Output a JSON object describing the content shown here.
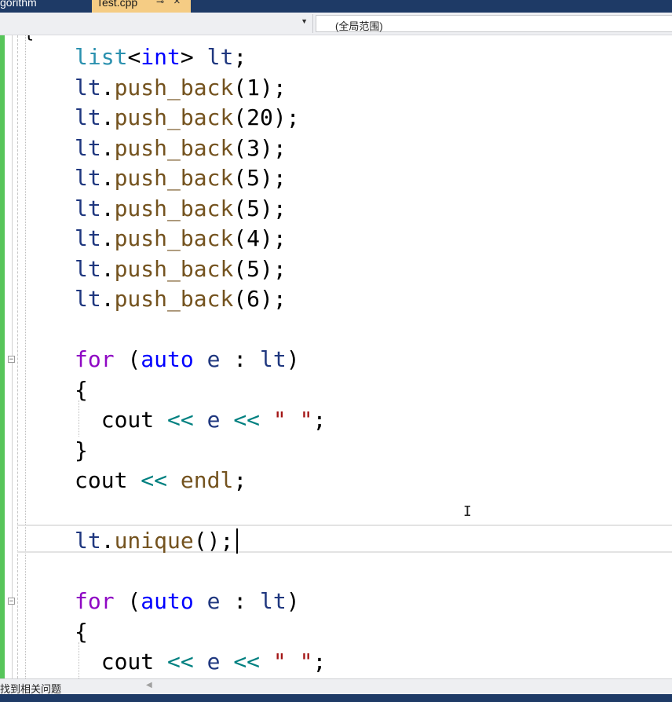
{
  "tabs": {
    "inactive_label": "gorithm",
    "active_label": "Test.cpp",
    "pin_glyph": "⊸",
    "close_glyph": "×"
  },
  "navbar": {
    "scope_label": "(全局范围)"
  },
  "editor": {
    "top_glyph": "{",
    "caret_glyph": "I",
    "lines": [
      [
        {
          "t": "list",
          "c": "t-type"
        },
        {
          "t": "<"
        },
        {
          "t": "int",
          "c": "t-kw"
        },
        {
          "t": "> "
        },
        {
          "t": "lt",
          "c": "t-var"
        },
        {
          "t": ";"
        }
      ],
      [
        {
          "t": "lt",
          "c": "t-var"
        },
        {
          "t": "."
        },
        {
          "t": "push_back",
          "c": "t-fn"
        },
        {
          "t": "(1);"
        }
      ],
      [
        {
          "t": "lt",
          "c": "t-var"
        },
        {
          "t": "."
        },
        {
          "t": "push_back",
          "c": "t-fn"
        },
        {
          "t": "(20);"
        }
      ],
      [
        {
          "t": "lt",
          "c": "t-var"
        },
        {
          "t": "."
        },
        {
          "t": "push_back",
          "c": "t-fn"
        },
        {
          "t": "(3);"
        }
      ],
      [
        {
          "t": "lt",
          "c": "t-var"
        },
        {
          "t": "."
        },
        {
          "t": "push_back",
          "c": "t-fn"
        },
        {
          "t": "(5);"
        }
      ],
      [
        {
          "t": "lt",
          "c": "t-var"
        },
        {
          "t": "."
        },
        {
          "t": "push_back",
          "c": "t-fn"
        },
        {
          "t": "(5);"
        }
      ],
      [
        {
          "t": "lt",
          "c": "t-var"
        },
        {
          "t": "."
        },
        {
          "t": "push_back",
          "c": "t-fn"
        },
        {
          "t": "(4);"
        }
      ],
      [
        {
          "t": "lt",
          "c": "t-var"
        },
        {
          "t": "."
        },
        {
          "t": "push_back",
          "c": "t-fn"
        },
        {
          "t": "(5);"
        }
      ],
      [
        {
          "t": "lt",
          "c": "t-var"
        },
        {
          "t": "."
        },
        {
          "t": "push_back",
          "c": "t-fn"
        },
        {
          "t": "(6);"
        }
      ],
      [],
      [
        {
          "t": "for",
          "c": "t-ctl"
        },
        {
          "t": " ("
        },
        {
          "t": "auto",
          "c": "t-kw"
        },
        {
          "t": " "
        },
        {
          "t": "e",
          "c": "t-var"
        },
        {
          "t": " : "
        },
        {
          "t": "lt",
          "c": "t-var"
        },
        {
          "t": ")"
        }
      ],
      [
        {
          "t": "{"
        }
      ],
      [
        {
          "t": "  "
        },
        {
          "t": "cout",
          "c": ""
        },
        {
          "t": " "
        },
        {
          "t": "<<",
          "c": "t-op"
        },
        {
          "t": " "
        },
        {
          "t": "e",
          "c": "t-var"
        },
        {
          "t": " "
        },
        {
          "t": "<<",
          "c": "t-op"
        },
        {
          "t": " "
        },
        {
          "t": "\" \"",
          "c": "t-str"
        },
        {
          "t": ";"
        }
      ],
      [
        {
          "t": "}"
        }
      ],
      [
        {
          "t": "cout"
        },
        {
          "t": " "
        },
        {
          "t": "<<",
          "c": "t-op"
        },
        {
          "t": " "
        },
        {
          "t": "endl",
          "c": "t-fn"
        },
        {
          "t": ";"
        }
      ],
      [],
      [
        {
          "t": "lt",
          "c": "t-var"
        },
        {
          "t": "."
        },
        {
          "t": "unique",
          "c": "t-fn"
        },
        {
          "t": "();"
        }
      ],
      [],
      [
        {
          "t": "for",
          "c": "t-ctl"
        },
        {
          "t": " ("
        },
        {
          "t": "auto",
          "c": "t-kw"
        },
        {
          "t": " "
        },
        {
          "t": "e",
          "c": "t-var"
        },
        {
          "t": " : "
        },
        {
          "t": "lt",
          "c": "t-var"
        },
        {
          "t": ")"
        }
      ],
      [
        {
          "t": "{"
        }
      ],
      [
        {
          "t": "  "
        },
        {
          "t": "cout"
        },
        {
          "t": " "
        },
        {
          "t": "<<",
          "c": "t-op"
        },
        {
          "t": " "
        },
        {
          "t": "e",
          "c": "t-var"
        },
        {
          "t": " "
        },
        {
          "t": "<<",
          "c": "t-op"
        },
        {
          "t": " "
        },
        {
          "t": "\" \"",
          "c": "t-str"
        },
        {
          "t": ";"
        }
      ]
    ]
  },
  "statusbar": {
    "text": "找到相关问题"
  },
  "colors": {
    "tab_bar": "#1e3a66",
    "active_tab": "#f5cc84",
    "change_bar": "#57c55a",
    "type": "#2b91af",
    "keyword": "#0000ff",
    "control": "#8f08c4",
    "function": "#74531f",
    "operator": "#008080",
    "string": "#a31515",
    "variable": "#1f377f"
  }
}
